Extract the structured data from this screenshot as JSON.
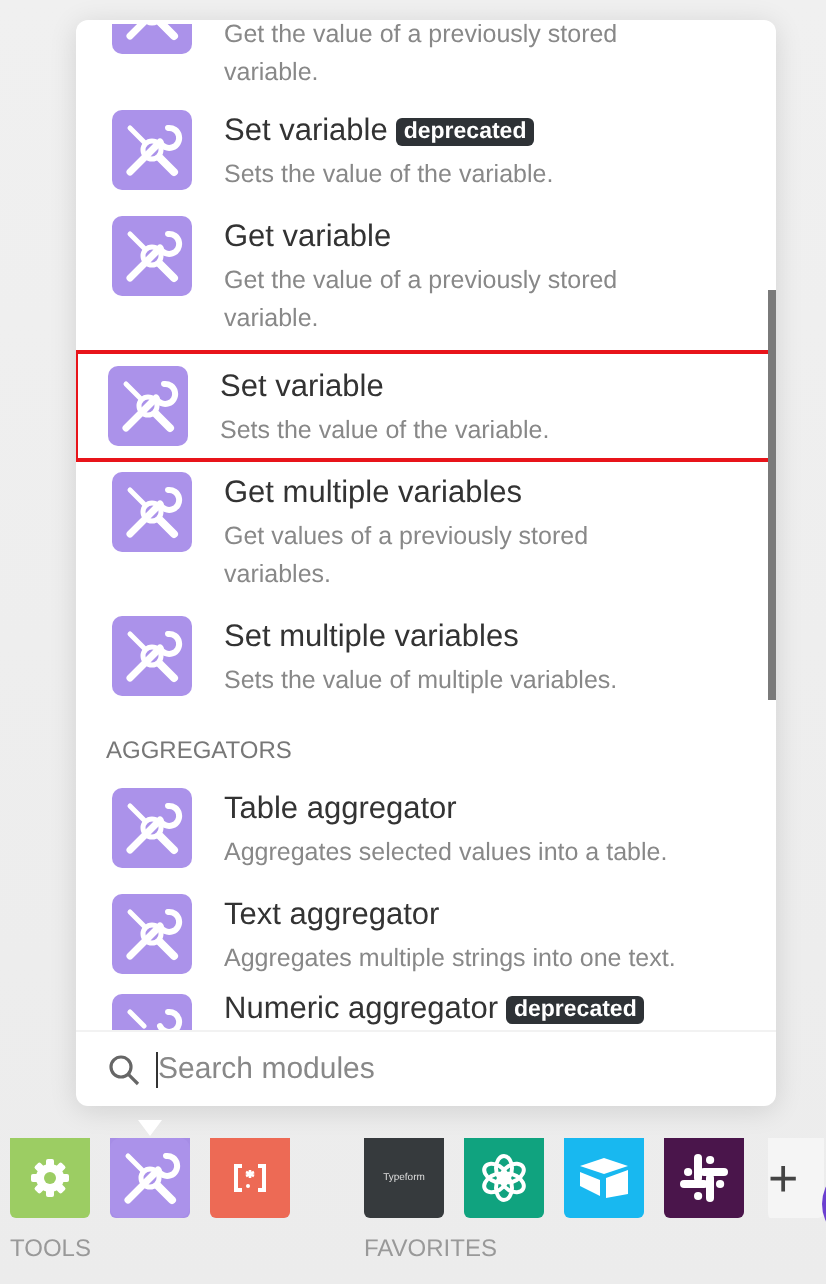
{
  "panel": {
    "items": [
      {
        "kind": "partial",
        "description": "Get the value of a previously stored variable."
      },
      {
        "kind": "module",
        "title": "Set variable",
        "badge": "deprecated",
        "description": "Sets the value of the variable.",
        "selected": false
      },
      {
        "kind": "module",
        "title": "Get variable",
        "description": "Get the value of a previously stored variable.",
        "selected": false
      },
      {
        "kind": "module",
        "title": "Set variable",
        "description": "Sets the value of the variable.",
        "selected": true
      },
      {
        "kind": "module",
        "title": "Get multiple variables",
        "description": "Get values of a previously stored variables.",
        "selected": false
      },
      {
        "kind": "module",
        "title": "Set multiple variables",
        "description": "Sets the value of multiple variables.",
        "selected": false
      },
      {
        "kind": "header",
        "title": "AGGREGATORS"
      },
      {
        "kind": "module",
        "title": "Table aggregator",
        "description": "Aggregates selected values into a table.",
        "selected": false
      },
      {
        "kind": "module",
        "title": "Text aggregator",
        "description": "Aggregates multiple strings into one text.",
        "selected": false
      },
      {
        "kind": "cut",
        "title": "Numeric aggregator",
        "badge": "deprecated"
      }
    ],
    "search": {
      "placeholder": "Search modules"
    }
  },
  "dock": {
    "groups": [
      {
        "label": "TOOLS",
        "tiles": [
          {
            "kind": "settings",
            "selected": false
          },
          {
            "kind": "tools",
            "selected": true
          },
          {
            "kind": "json",
            "selected": false
          }
        ]
      },
      {
        "label": "FAVORITES",
        "tiles": [
          {
            "kind": "typeform",
            "text": "Typeform",
            "selected": false
          },
          {
            "kind": "openai",
            "selected": false
          },
          {
            "kind": "airtable",
            "selected": false
          },
          {
            "kind": "slack",
            "selected": false
          },
          {
            "kind": "add",
            "text": "+",
            "selected": false
          }
        ]
      }
    ]
  }
}
